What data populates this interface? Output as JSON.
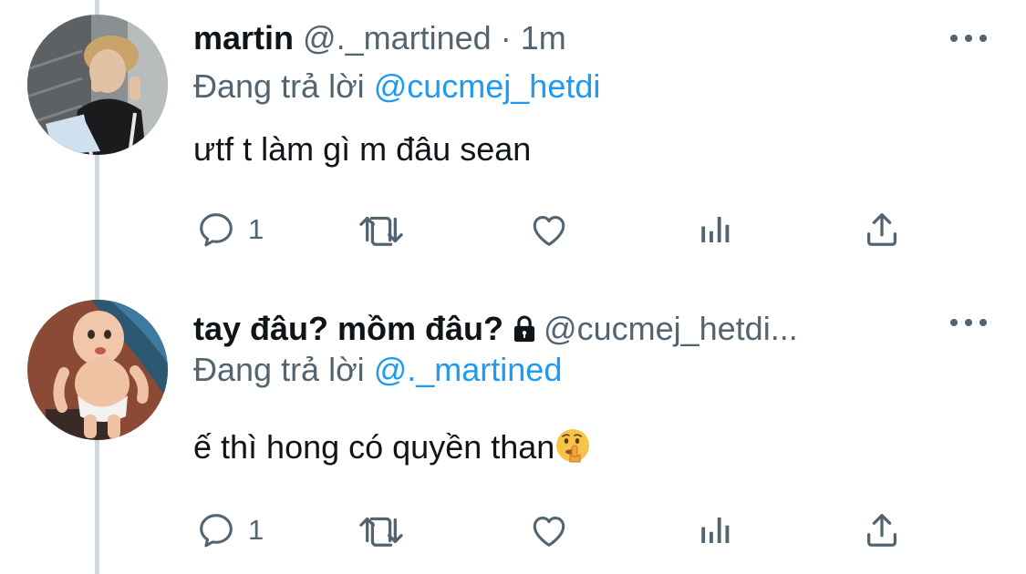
{
  "tweets": [
    {
      "display_name": "martin",
      "handle": "@._martined",
      "separator": "·",
      "time": "1m",
      "reply_prefix": "Đang trả lời",
      "reply_mention": "@cucmej_hetdi",
      "text": "ưtf t làm gì m đâu sean",
      "reply_count": "1",
      "protected": false,
      "avatar": "photo-person-icon"
    },
    {
      "display_name": "tay đâu? mồm đâu?",
      "handle": "@cucmej_hetdi...",
      "reply_prefix": "Đang trả lời",
      "reply_mention": "@._martined",
      "text": "ế thì hong có quyền than",
      "emoji": "shushing-face-emoji",
      "reply_count": "1",
      "protected": true,
      "avatar": "baby-character-icon"
    }
  ],
  "icons": {
    "more": "more-icon",
    "reply": "reply-icon",
    "retweet": "retweet-icon",
    "like": "like-icon",
    "analytics": "analytics-icon",
    "share": "share-icon",
    "lock": "lock-icon"
  },
  "colors": {
    "text": "#0f1419",
    "secondary": "#536471",
    "link": "#1d9bf0",
    "thread_line": "#cfd9de",
    "background": "#ffffff"
  }
}
